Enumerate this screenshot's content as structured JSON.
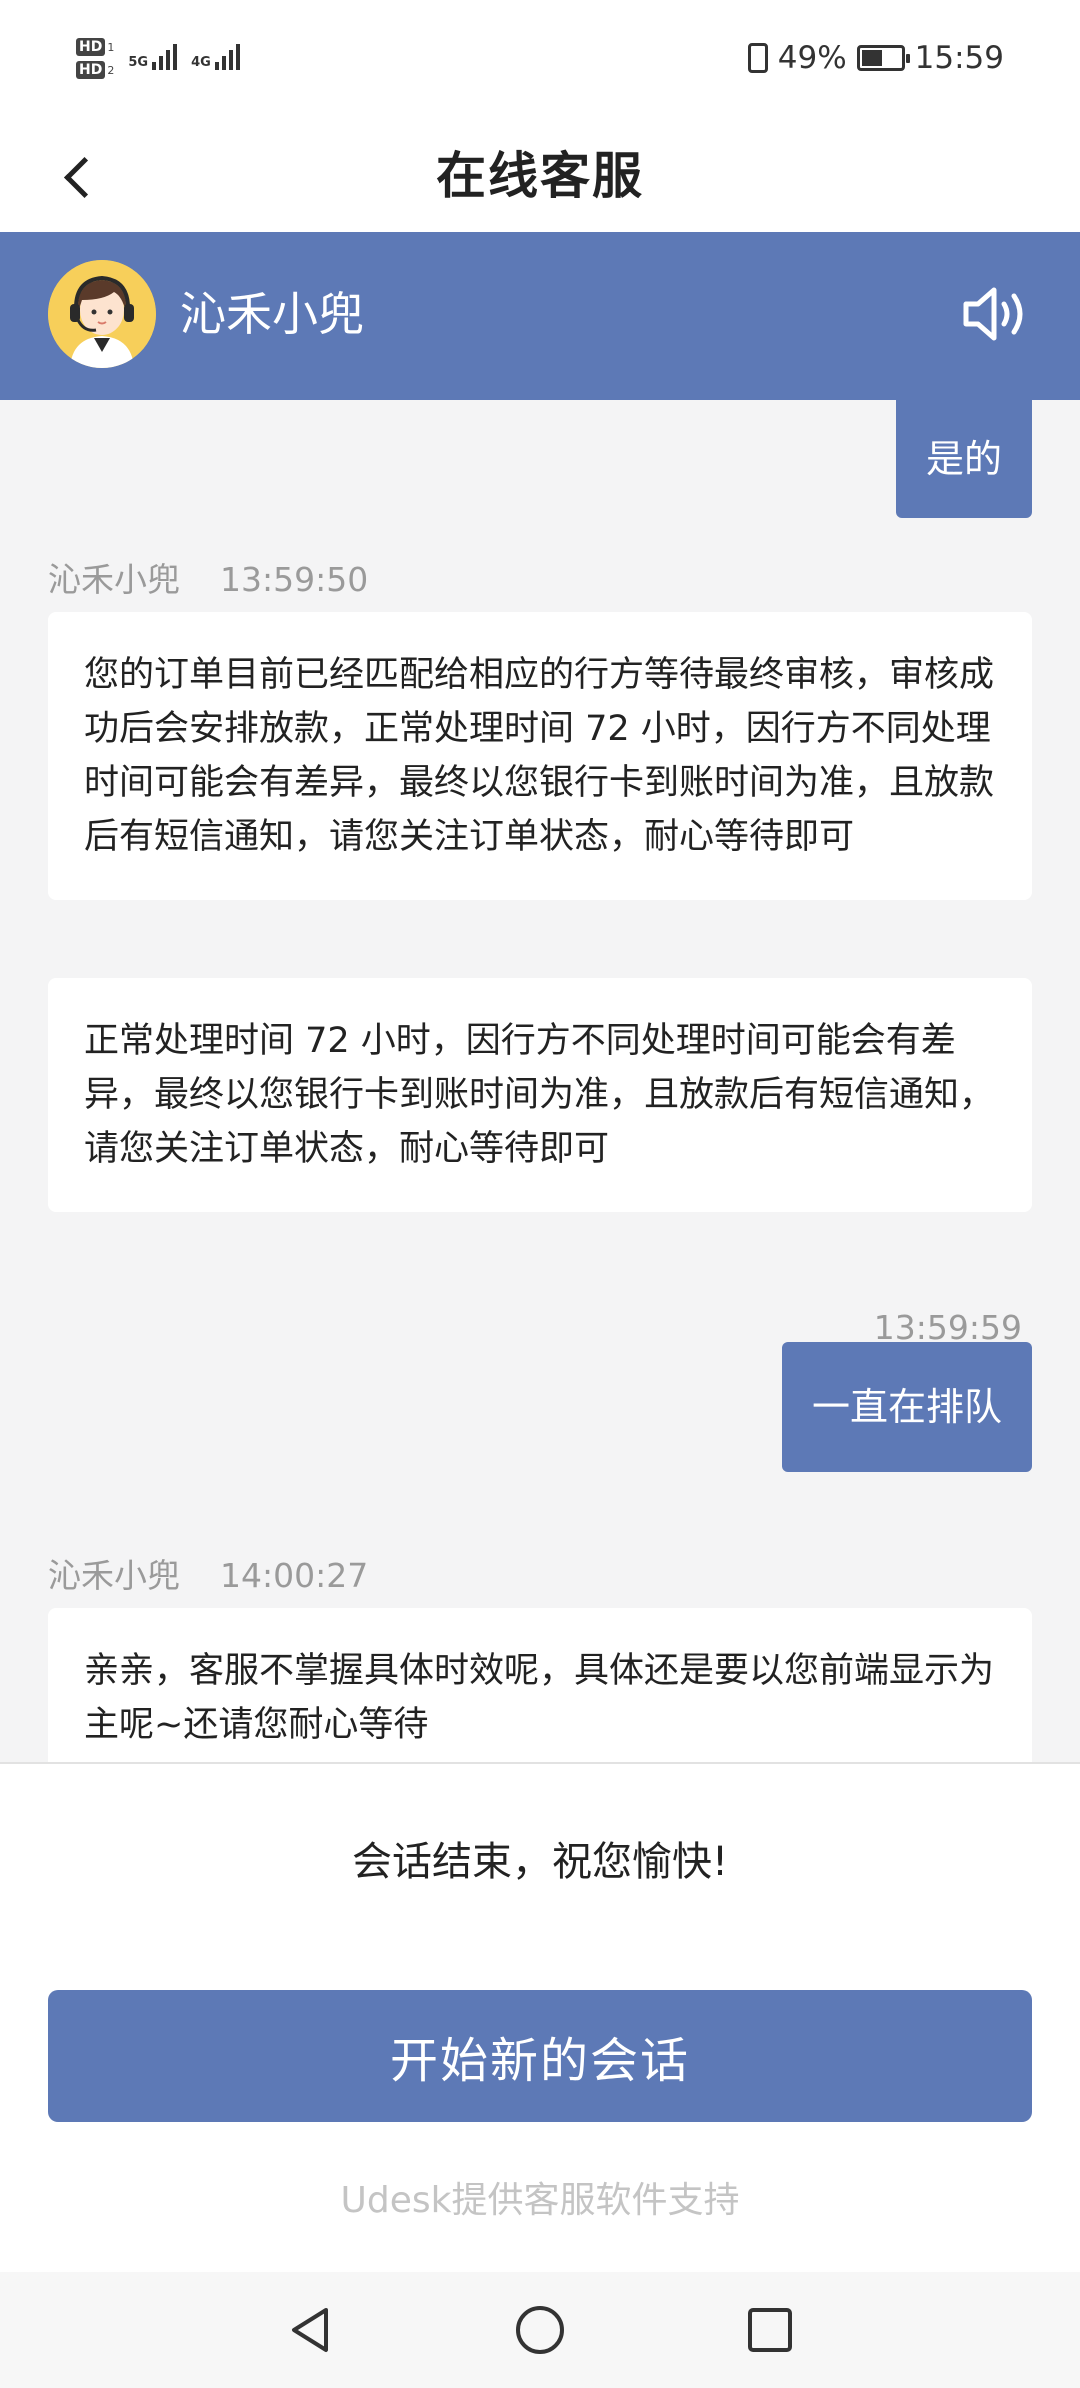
{
  "status_bar": {
    "hd1": "HD",
    "hd1_num": "1",
    "hd2": "HD",
    "hd2_num": "2",
    "net1": "5G",
    "net2": "4G",
    "battery_percent": "49%",
    "time": "15:59",
    "battery_level": 0.49
  },
  "nav": {
    "title": "在线客服",
    "back_icon": "chevron-left-icon"
  },
  "agent": {
    "name": "沁禾小兜",
    "avatar_icon": "support-agent-avatar",
    "speaker_icon": "speaker-icon",
    "color": "#5d79b6"
  },
  "messages": [
    {
      "from": "user",
      "text": "是的"
    },
    {
      "from": "agent",
      "sender": "沁禾小兜",
      "time": "13:59:50",
      "text": "您的订单目前已经匹配给相应的行方等待最终审核，审核成功后会安排放款，正常处理时间 72 小时，因行方不同处理时间可能会有差异，最终以您银行卡到账时间为准，且放款后有短信通知，请您关注订单状态，耐心等待即可"
    },
    {
      "from": "agent",
      "text": "正常处理时间 72 小时，因行方不同处理时间可能会有差异，最终以您银行卡到账时间为准，且放款后有短信通知，请您关注订单状态，耐心等待即可"
    },
    {
      "from": "user",
      "time": "13:59:59",
      "text": "一直在排队"
    },
    {
      "from": "agent",
      "sender": "沁禾小兜",
      "time": "14:00:27",
      "text": "亲亲，客服不掌握具体时效呢，具体还是要以您前端显示为主呢~还请您耐心等待"
    }
  ],
  "footer": {
    "end_text": "会话结束，祝您愉快!",
    "new_session_label": "开始新的会话",
    "powered_by": "Udesk提供客服软件支持"
  },
  "system_nav": {
    "back_icon": "triangle-back-icon",
    "home_icon": "circle-home-icon",
    "recents_icon": "square-recents-icon"
  }
}
